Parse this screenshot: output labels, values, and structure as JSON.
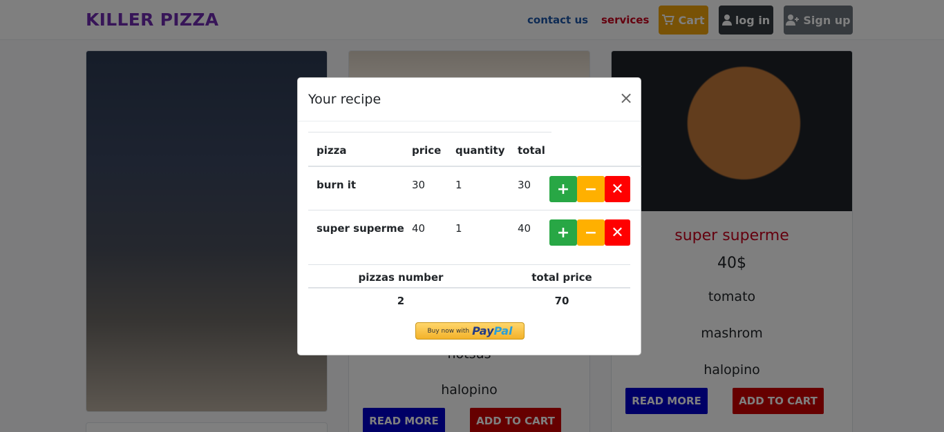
{
  "navbar": {
    "brand": "KILLER PIZZA",
    "links": {
      "contact": "contact us",
      "services": "services"
    },
    "cart": "Cart",
    "login": "log in",
    "signup": "Sign up"
  },
  "cards": {
    "middle": {
      "ingredients": [
        "hotsus",
        "halopino"
      ],
      "read_more": "READ MORE",
      "add_to_cart": "ADD TO CART"
    },
    "right": {
      "title": "super superme",
      "price": "40$",
      "ingredients": [
        "tomato",
        "mashrom",
        "halopino"
      ],
      "read_more": "READ MORE",
      "add_to_cart": "ADD TO CART"
    }
  },
  "modal": {
    "title": "Your recipe",
    "close": "×",
    "table": {
      "headers": [
        "pizza",
        "price",
        "quantity",
        "total"
      ],
      "rows": [
        {
          "pizza": "burn it",
          "price": "30",
          "quantity": "1",
          "total": "30"
        },
        {
          "pizza": "super superme",
          "price": "40",
          "quantity": "1",
          "total": "40"
        }
      ]
    },
    "summary": {
      "headers": [
        "pizzas number",
        "total price"
      ],
      "values": [
        "2",
        "70"
      ]
    },
    "paypal": {
      "small": "Buy now with",
      "logo_a": "Pay",
      "logo_b": "Pal"
    }
  },
  "colors": {
    "brand": "#6f2ab0",
    "contact": "#1d56a8",
    "services": "#c8001c",
    "cart": "#f0a40c",
    "login": "#343a40",
    "signup": "#6c757d",
    "plus": "#28a745",
    "minus": "#ffb000",
    "remove": "#ff0000"
  },
  "icons": [
    "cart-icon",
    "user-icon",
    "user-plus-icon",
    "close-icon",
    "plus-icon",
    "minus-icon",
    "remove-icon"
  ]
}
